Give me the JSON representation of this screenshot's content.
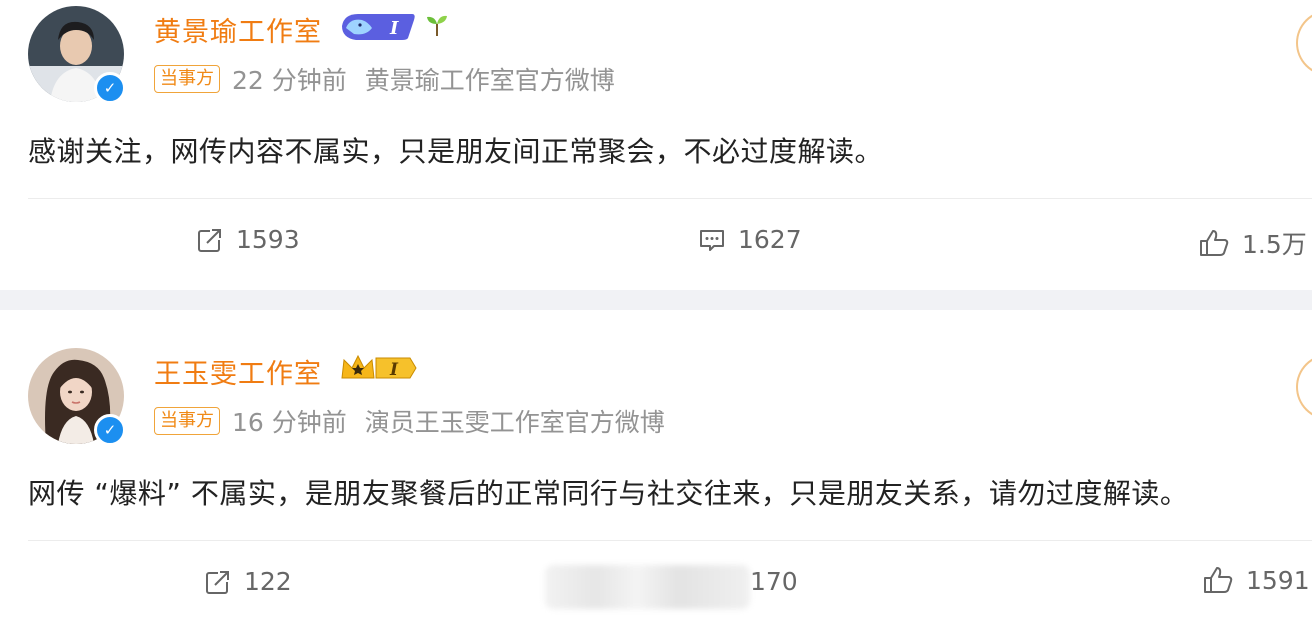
{
  "posts": [
    {
      "name": "黄景瑜工作室",
      "tag": "当事方",
      "time": "22 分钟前",
      "source": "黄景瑜工作室官方微博",
      "content": "感谢关注，网传内容不属实，只是朋友间正常聚会，不必过度解读。",
      "reposts": "1593",
      "comments": "1627",
      "likes": "1.5万",
      "vip_level": "I"
    },
    {
      "name": "王玉雯工作室",
      "tag": "当事方",
      "time": "16 分钟前",
      "source": "演员王玉雯工作室官方微博",
      "content": "网传 “爆料” 不属实，是朋友聚餐后的正常同行与社交往来，只是朋友关系，请勿过度解读。",
      "reposts": "122",
      "comments": "170",
      "likes": "1591",
      "vip_level": "I"
    }
  ],
  "icons": [
    "repost-icon",
    "comment-icon",
    "like-icon",
    "verified-icon",
    "sprout-icon",
    "crown-icon",
    "whale-icon"
  ],
  "colors": {
    "name": "#f07c12",
    "meta": "#939393",
    "verified": "#1c8ff0",
    "separator": "#f1f2f5"
  }
}
